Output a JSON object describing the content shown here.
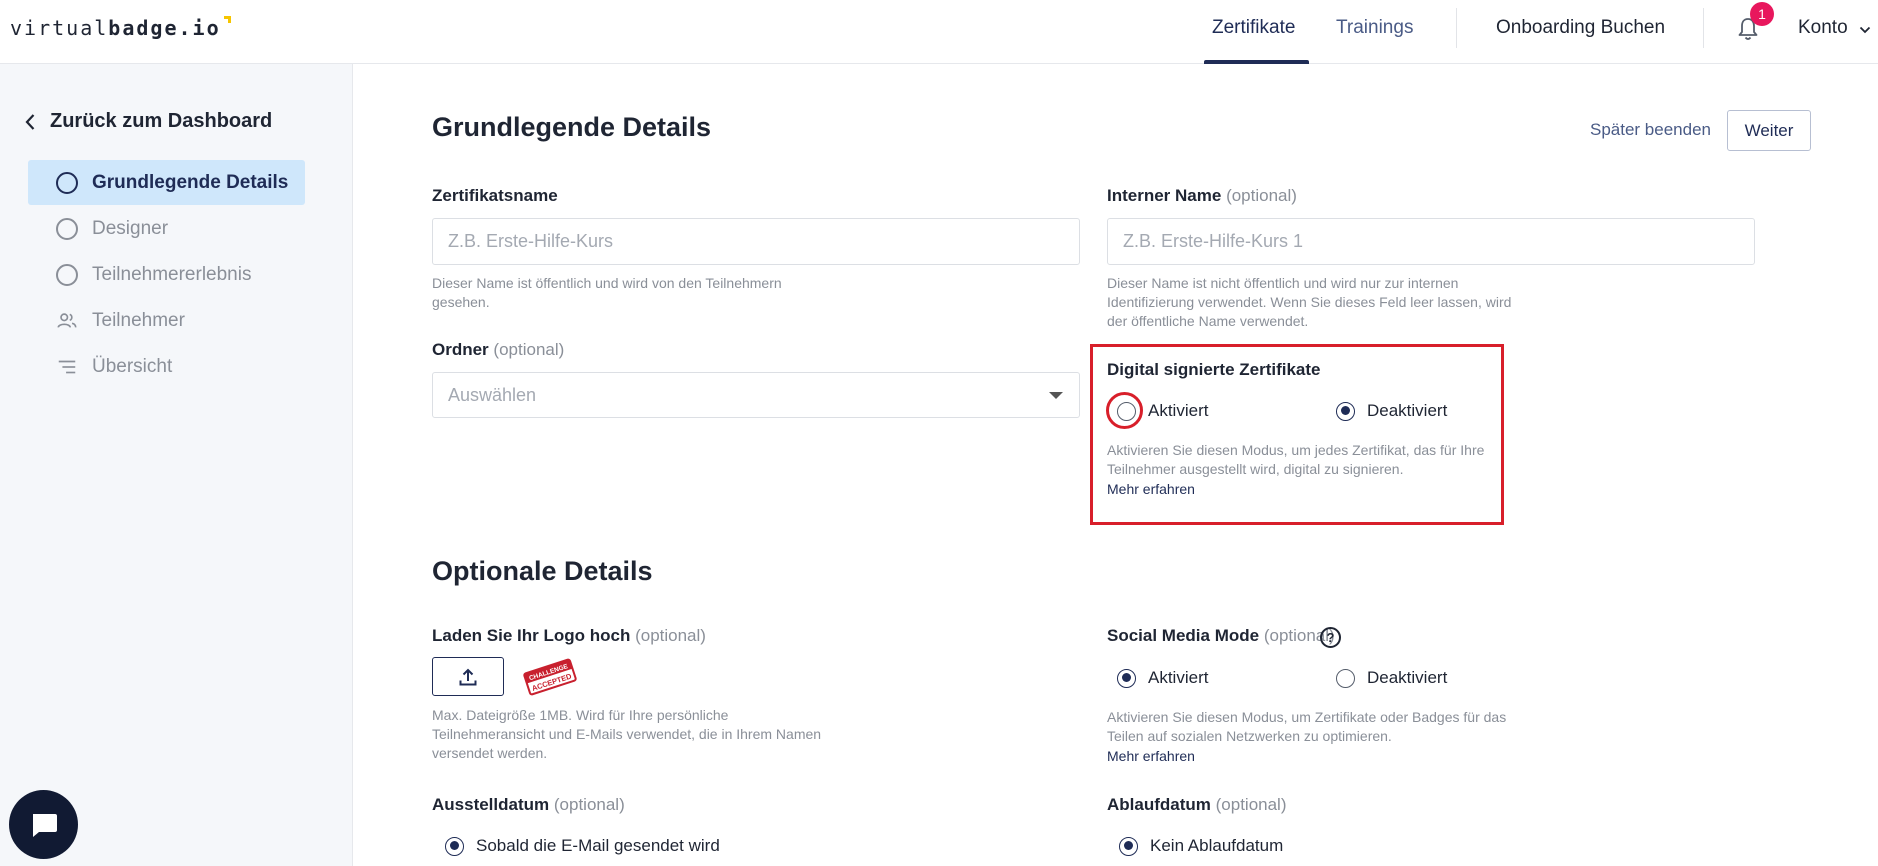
{
  "brand": {
    "logo_light": "virtual",
    "logo_bold": "badge.io"
  },
  "nav": {
    "links": [
      "Zertifikate",
      "Trainings",
      "Onboarding Buchen"
    ],
    "notification_count": "1",
    "account": "Konto"
  },
  "sidebar": {
    "back": "Zurück zum Dashboard",
    "items": [
      {
        "label": "Grundlegende Details",
        "icon": "circle-step-icon",
        "active": true
      },
      {
        "label": "Designer",
        "icon": "circle-step-icon"
      },
      {
        "label": "Teilnehmererlebnis",
        "icon": "circle-step-icon"
      },
      {
        "label": "Teilnehmer",
        "icon": "people-icon"
      },
      {
        "label": "Übersicht",
        "icon": "list-icon"
      }
    ]
  },
  "basic": {
    "title": "Grundlegende Details",
    "later": "Später beenden",
    "next": "Weiter",
    "cert_name": {
      "label": "Zertifikatsname",
      "placeholder": "Z.B. Erste-Hilfe-Kurs",
      "help_1": "Dieser Name ist öffentlich und wird von den Teilnehmern",
      "help_2": "gesehen."
    },
    "internal_name": {
      "label": "Interner Name",
      "optional": "(optional)",
      "placeholder": "Z.B. Erste-Hilfe-Kurs 1",
      "help_1": "Dieser Name ist nicht öffentlich und wird nur zur internen",
      "help_2": "Identifizierung verwendet. Wenn Sie dieses Feld leer lassen, wird",
      "help_3": "der öffentliche Name verwendet."
    },
    "folder": {
      "label": "Ordner",
      "optional": "(optional)",
      "value": "Auswählen"
    },
    "digital_signed": {
      "label": "Digital signierte Zertifikate",
      "option_on": "Aktiviert",
      "option_off": "Deaktiviert",
      "selected": "Deaktiviert",
      "help_1": "Aktivieren Sie diesen Modus, um jedes Zertifikat, das für Ihre",
      "help_2": "Teilnehmer ausgestellt wird, digital zu signieren.",
      "more": "Mehr erfahren"
    }
  },
  "optional": {
    "title": "Optionale Details",
    "logo": {
      "label": "Laden Sie Ihr Logo hoch",
      "optional": "(optional)",
      "stamp_text": "CHALLENGE ACCEPTED",
      "help_1": "Max. Dateigröße 1MB. Wird für Ihre persönliche",
      "help_2": "Teilnehmeransicht und E-Mails verwendet, die in Ihrem Namen",
      "help_3": "versendet werden."
    },
    "social": {
      "label": "Social Media Mode",
      "optional": "(optional)",
      "help_icon": "?",
      "option_on": "Aktiviert",
      "option_off": "Deaktiviert",
      "selected": "Aktiviert",
      "help_1": "Aktivieren Sie diesen Modus, um Zertifikate oder Badges für das",
      "help_2": "Teilen auf sozialen Netzwerken zu optimieren.",
      "more": "Mehr erfahren"
    },
    "issue_date": {
      "label": "Ausstelldatum",
      "optional": "(optional)",
      "option": "Sobald die E-Mail gesendet wird"
    },
    "expiry_date": {
      "label": "Ablaufdatum",
      "optional": "(optional)",
      "option": "Kein Ablaufdatum"
    }
  },
  "colors": {
    "primary": "#1f2c56",
    "active_bg": "#cfe7fb",
    "badge": "#e8175d",
    "highlight": "#d81f2a",
    "logo_accent": "#f6c500"
  }
}
